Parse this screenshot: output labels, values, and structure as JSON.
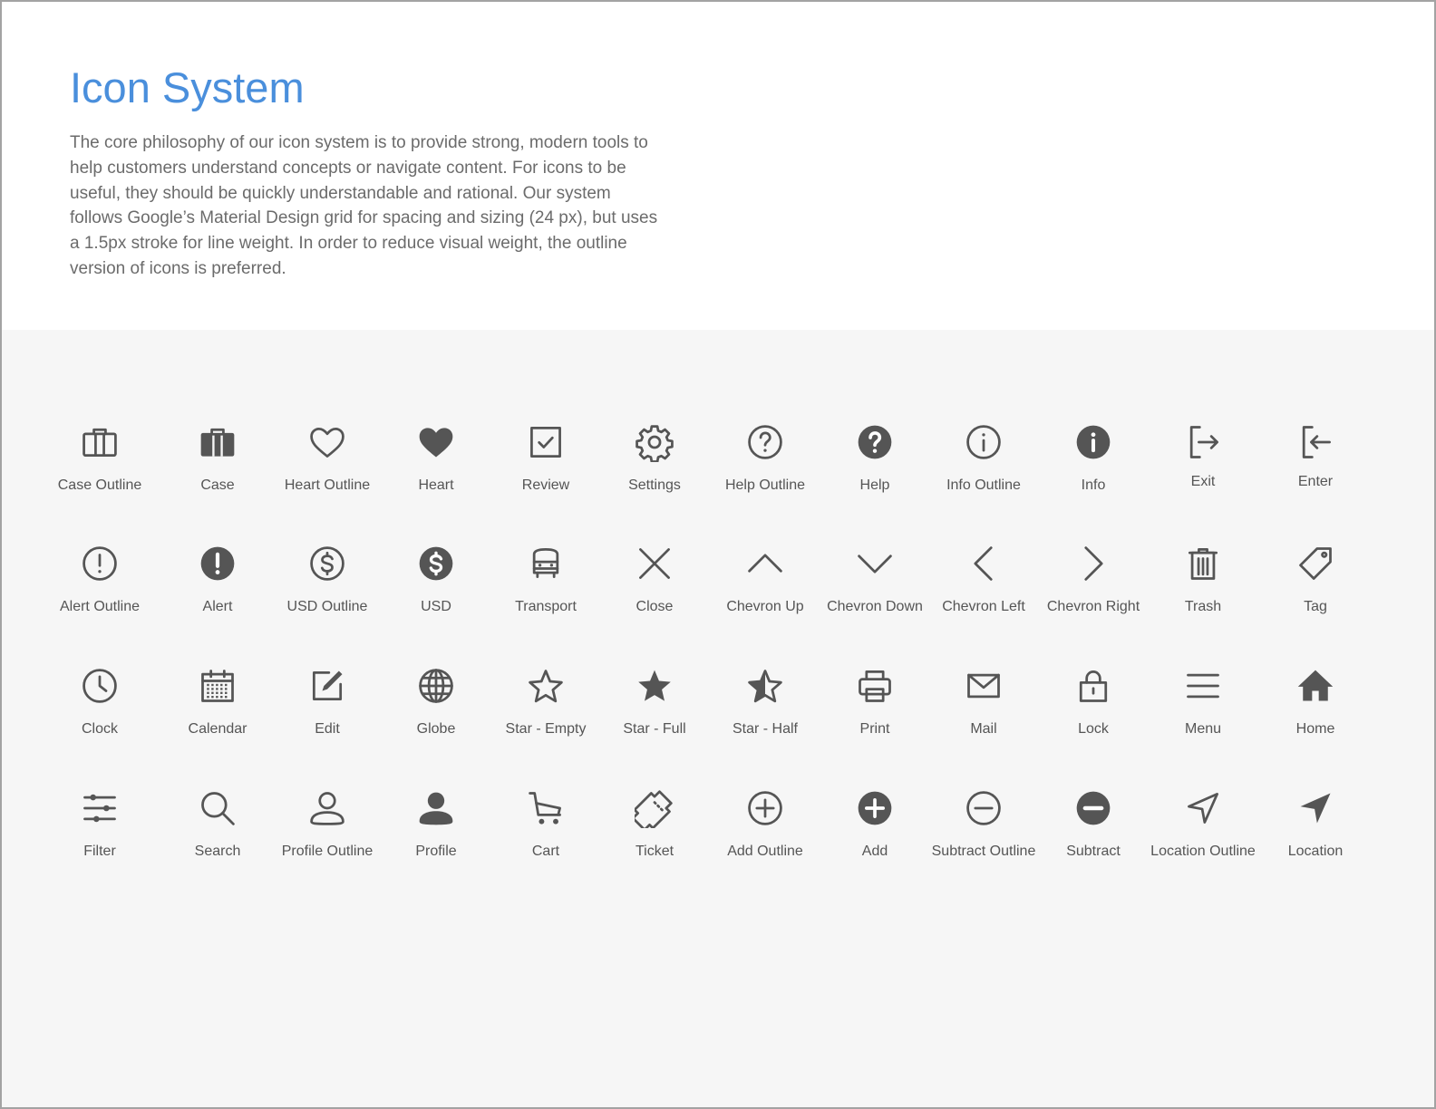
{
  "header": {
    "title": "Icon System",
    "description": "The core philosophy of our icon system is to provide strong, modern tools to help customers understand concepts or navigate content. For icons to be useful, they should be quickly understandable and rational. Our system follows Google’s Material Design grid for spacing and sizing (24 px), but uses a 1.5px stroke for line weight. In order to reduce visual weight, the outline version of icons is preferred."
  },
  "colors": {
    "title": "#4a8fdc",
    "body_text": "#6b6b6b",
    "icon": "#555555",
    "panel_bg": "#f6f6f6"
  },
  "rows": [
    {
      "icons": [
        {
          "label": "Case Outline",
          "icon": "case-outline-icon"
        },
        {
          "label": "Case",
          "icon": "case-icon"
        },
        {
          "label": "Heart Outline",
          "icon": "heart-outline-icon"
        },
        {
          "label": "Heart",
          "icon": "heart-icon"
        },
        {
          "label": "Review",
          "icon": "review-icon"
        },
        {
          "label": "Settings",
          "icon": "settings-icon"
        },
        {
          "label": "Help Outline",
          "icon": "help-outline-icon"
        },
        {
          "label": "Help",
          "icon": "help-icon"
        },
        {
          "label": "Info Outline",
          "icon": "info-outline-icon"
        },
        {
          "label": "Info",
          "icon": "info-icon"
        },
        {
          "label": "Exit",
          "icon": "exit-icon"
        },
        {
          "label": "Enter",
          "icon": "enter-icon"
        }
      ]
    },
    {
      "icons": [
        {
          "label": "Alert Outline",
          "icon": "alert-outline-icon"
        },
        {
          "label": "Alert",
          "icon": "alert-icon"
        },
        {
          "label": "USD Outline",
          "icon": "usd-outline-icon"
        },
        {
          "label": "USD",
          "icon": "usd-icon"
        },
        {
          "label": "Transport",
          "icon": "transport-icon"
        },
        {
          "label": "Close",
          "icon": "close-icon"
        },
        {
          "label": "Chevron Up",
          "icon": "chevron-up-icon"
        },
        {
          "label": "Chevron Down",
          "icon": "chevron-down-icon"
        },
        {
          "label": "Chevron Left",
          "icon": "chevron-left-icon"
        },
        {
          "label": "Chevron Right",
          "icon": "chevron-right-icon"
        },
        {
          "label": "Trash",
          "icon": "trash-icon"
        },
        {
          "label": "Tag",
          "icon": "tag-icon"
        }
      ]
    },
    {
      "icons": [
        {
          "label": "Clock",
          "icon": "clock-icon"
        },
        {
          "label": "Calendar",
          "icon": "calendar-icon"
        },
        {
          "label": "Edit",
          "icon": "edit-icon"
        },
        {
          "label": "Globe",
          "icon": "globe-icon"
        },
        {
          "label": "Star - Empty",
          "icon": "star-empty-icon"
        },
        {
          "label": "Star - Full",
          "icon": "star-full-icon"
        },
        {
          "label": "Star - Half",
          "icon": "star-half-icon"
        },
        {
          "label": "Print",
          "icon": "print-icon"
        },
        {
          "label": "Mail",
          "icon": "mail-icon"
        },
        {
          "label": "Lock",
          "icon": "lock-icon"
        },
        {
          "label": "Menu",
          "icon": "menu-icon"
        },
        {
          "label": "Home",
          "icon": "home-icon"
        }
      ]
    },
    {
      "icons": [
        {
          "label": "Filter",
          "icon": "filter-icon"
        },
        {
          "label": "Search",
          "icon": "search-icon"
        },
        {
          "label": "Profile Outline",
          "icon": "profile-outline-icon"
        },
        {
          "label": "Profile",
          "icon": "profile-icon"
        },
        {
          "label": "Cart",
          "icon": "cart-icon"
        },
        {
          "label": "Ticket",
          "icon": "ticket-icon"
        },
        {
          "label": "Add Outline",
          "icon": "add-outline-icon"
        },
        {
          "label": "Add",
          "icon": "add-icon"
        },
        {
          "label": "Subtract Outline",
          "icon": "subtract-outline-icon"
        },
        {
          "label": "Subtract",
          "icon": "subtract-icon"
        },
        {
          "label": "Location Outline",
          "icon": "location-outline-icon"
        },
        {
          "label": "Location",
          "icon": "location-icon"
        }
      ]
    }
  ]
}
